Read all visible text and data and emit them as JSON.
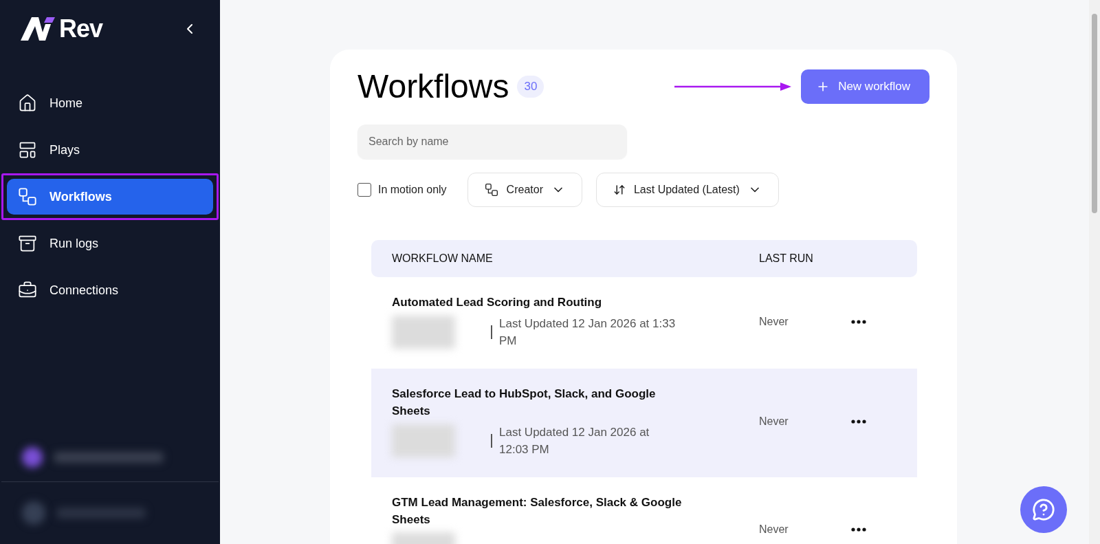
{
  "sidebar": {
    "logo": "Rev",
    "items": [
      {
        "label": "Home",
        "selected": false,
        "highlighted": false
      },
      {
        "label": "Plays",
        "selected": false,
        "highlighted": false
      },
      {
        "label": "Workflows",
        "selected": true,
        "highlighted": true
      },
      {
        "label": "Run logs",
        "selected": false,
        "highlighted": false
      },
      {
        "label": "Connections",
        "selected": false,
        "highlighted": false
      }
    ]
  },
  "header": {
    "title": "Workflows",
    "count": "30",
    "new_button": "New workflow",
    "annotation_arrow": true
  },
  "search": {
    "placeholder": "Search by name"
  },
  "filters": {
    "motion": {
      "label": "In motion only",
      "checked": false
    },
    "creator": "Creator",
    "sort": "Last Updated (Latest)"
  },
  "table": {
    "columns": [
      "WORKFLOW NAME",
      "LAST RUN"
    ],
    "rows": [
      {
        "name": "Automated Lead Scoring and Routing",
        "updated": "Last Updated 12 Jan 2026 at 1:33 PM",
        "last_run": "Never",
        "hovered": false
      },
      {
        "name": "Salesforce Lead to HubSpot, Slack, and Google Sheets",
        "updated": "Last Updated 12 Jan 2026 at 12:03 PM",
        "last_run": "Never",
        "hovered": true
      },
      {
        "name": "GTM Lead Management: Salesforce, Slack & Google Sheets",
        "last_run": "Never",
        "hovered": false
      }
    ]
  }
}
